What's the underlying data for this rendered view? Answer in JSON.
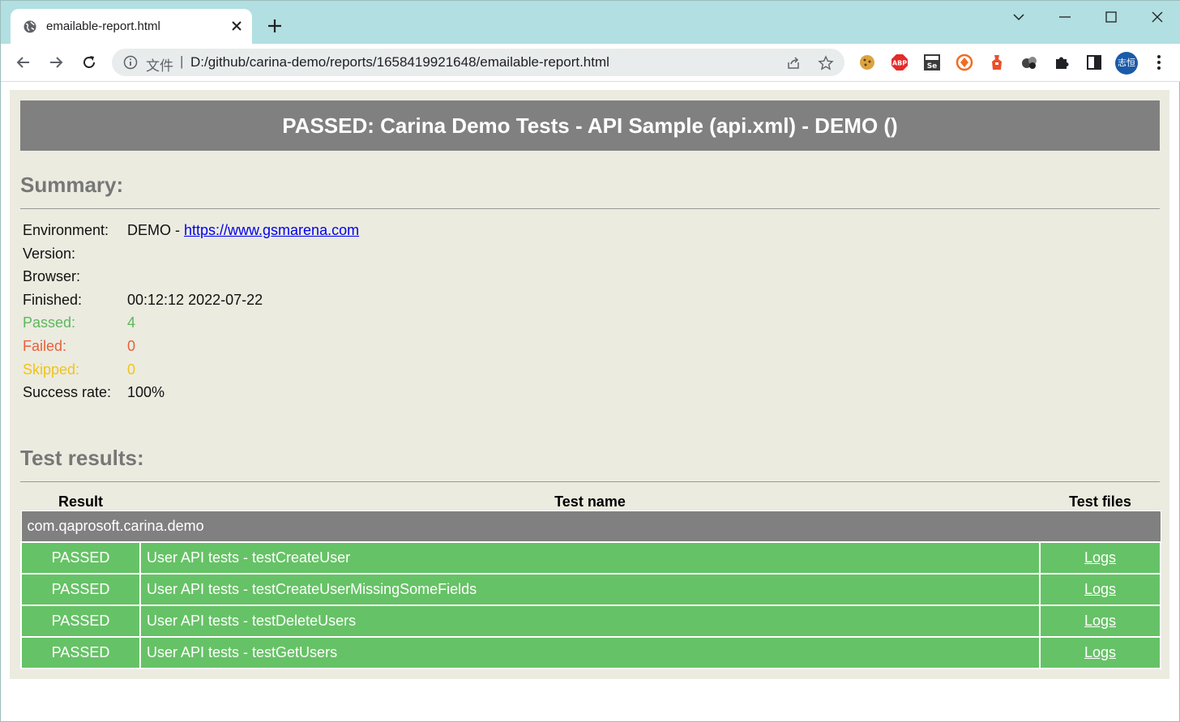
{
  "browser": {
    "tab_title": "emailable-report.html",
    "omnibox_scheme": "文件",
    "omnibox_separator": "|",
    "url": "D:/github/carina-demo/reports/1658419921648/emailable-report.html",
    "extensions": [
      "cookie-extension-icon",
      "adblock-plus-icon",
      "selenium-ide-icon",
      "orange-extension-icon",
      "red-extension-icon",
      "dots-extension-icon",
      "puzzle-icon",
      "side-panel-icon"
    ],
    "profile_initials": "志恒"
  },
  "report": {
    "banner_title": "PASSED: Carina Demo Tests - API Sample (api.xml) - DEMO ()",
    "summary_heading": "Summary:",
    "summary": {
      "environment_label": "Environment:",
      "environment_value": "DEMO - ",
      "environment_link": "https://www.gsmarena.com",
      "version_label": "Version:",
      "browser_label": "Browser:",
      "finished_label": "Finished:",
      "finished_value": "00:12:12 2022-07-22",
      "passed_label": "Passed:",
      "passed_value": "4",
      "failed_label": "Failed:",
      "failed_value": "0",
      "skipped_label": "Skipped:",
      "skipped_value": "0",
      "success_label": "Success rate:",
      "success_value": "100%"
    },
    "colors": {
      "passed": "#5cb85c",
      "failed": "#e8603c",
      "skipped": "#f0c419",
      "row_pass_bg": "#66c266",
      "banner_bg": "#808080"
    },
    "results_heading": "Test results:",
    "table": {
      "headers": [
        "Result",
        "Test name",
        "Test files"
      ],
      "package": "com.qaprosoft.carina.demo",
      "rows": [
        {
          "result": "PASSED",
          "name": "User API tests - testCreateUser",
          "files": "Logs"
        },
        {
          "result": "PASSED",
          "name": "User API tests - testCreateUserMissingSomeFields",
          "files": "Logs"
        },
        {
          "result": "PASSED",
          "name": "User API tests - testDeleteUsers",
          "files": "Logs"
        },
        {
          "result": "PASSED",
          "name": "User API tests - testGetUsers",
          "files": "Logs"
        }
      ]
    }
  }
}
